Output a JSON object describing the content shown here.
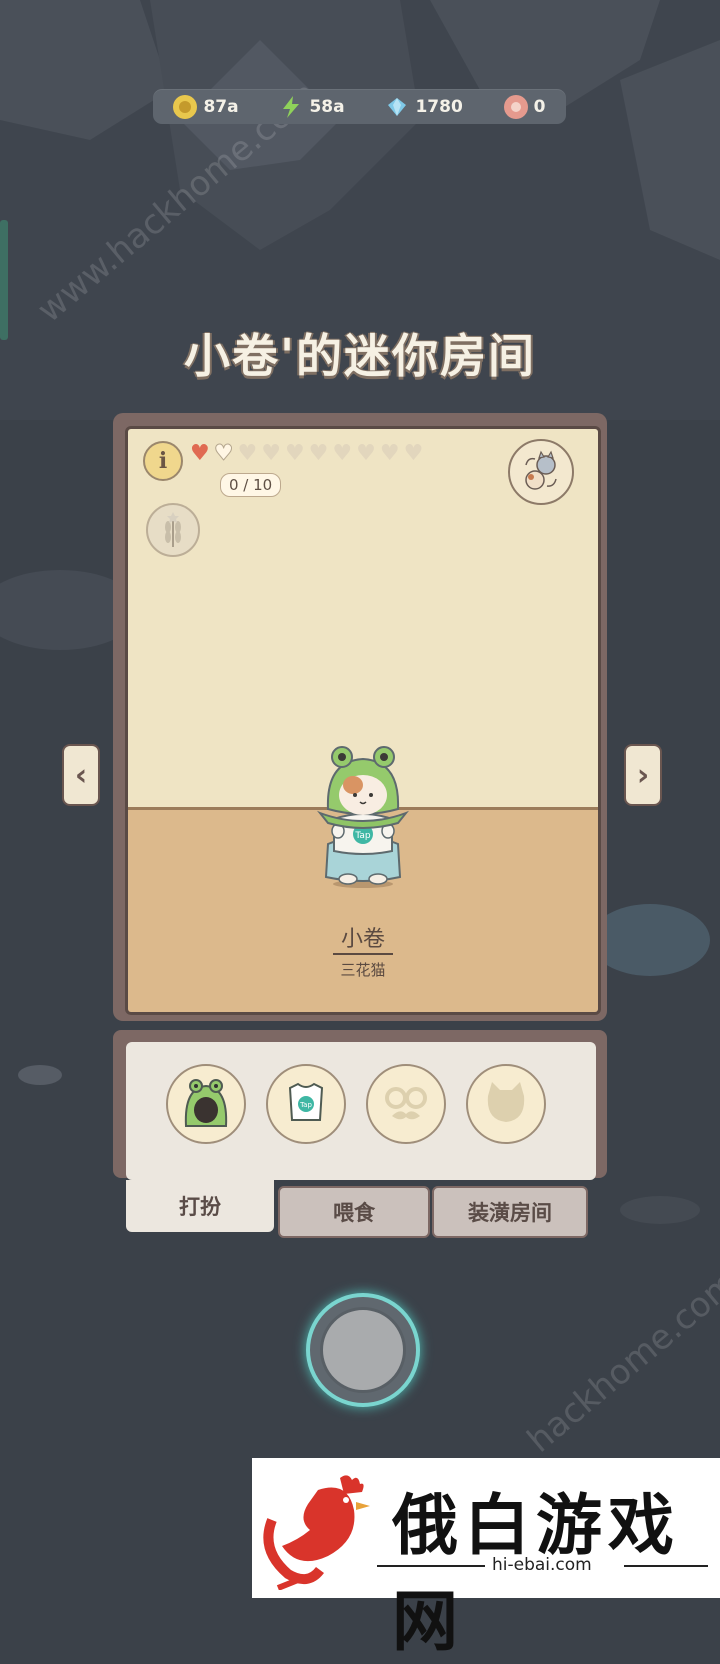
{
  "resources": [
    {
      "icon": "gold-coin-icon",
      "value": "87a",
      "color": "#e8c74d"
    },
    {
      "icon": "energy-bolt-icon",
      "value": "58a",
      "color": "#8fd15a"
    },
    {
      "icon": "diamond-icon",
      "value": "1780",
      "color": "#7fc9e8"
    },
    {
      "icon": "fish-badge-icon",
      "value": "0",
      "color": "#e59a8e"
    }
  ],
  "title": "小卷'的迷你房间",
  "room": {
    "hearts_filled": 1,
    "hearts_total": 10,
    "heart_progress": "0 / 10",
    "cat_name": "小卷",
    "cat_breed": "三花猫",
    "shirt_logo": "Tap"
  },
  "items": [
    {
      "icon": "frog-hood-icon"
    },
    {
      "icon": "tap-shirt-icon",
      "label": "Tap"
    },
    {
      "icon": "glasses-mustache-icon"
    },
    {
      "icon": "cat-mask-icon"
    }
  ],
  "tabs": [
    {
      "label": "打扮",
      "active": true
    },
    {
      "label": "喂食",
      "active": false
    },
    {
      "label": "装潢房间",
      "active": false
    }
  ],
  "watermarks": {
    "top": "www.hackhome.com",
    "bottom": "hackhome.com"
  },
  "banner": {
    "name": "俄白游戏网",
    "url": "hi-ebai.com"
  }
}
